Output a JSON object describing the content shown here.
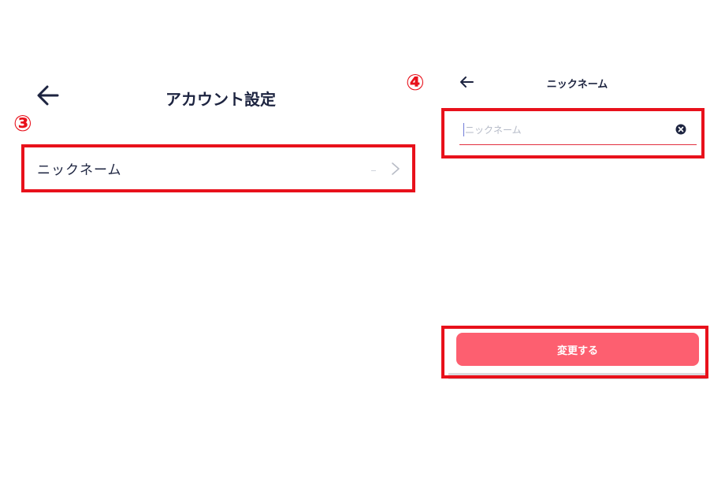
{
  "left_screen": {
    "title": "アカウント設定",
    "step_badge": "③",
    "rows": [
      {
        "label": "ニックネーム",
        "icon": "chevron-right-icon"
      }
    ],
    "back_icon": "arrow-left-icon"
  },
  "right_screen": {
    "title": "ニックネーム",
    "step_badge": "④",
    "back_icon": "arrow-left-icon",
    "nickname_field": {
      "value": "",
      "placeholder": "ニックネーム",
      "clear_icon": "clear-circle-icon"
    },
    "submit_label": "変更する"
  },
  "colors": {
    "highlight": "#e8111b",
    "button": "#fd5f70",
    "text": "#1d2440",
    "input_underline": "#e2303f"
  }
}
